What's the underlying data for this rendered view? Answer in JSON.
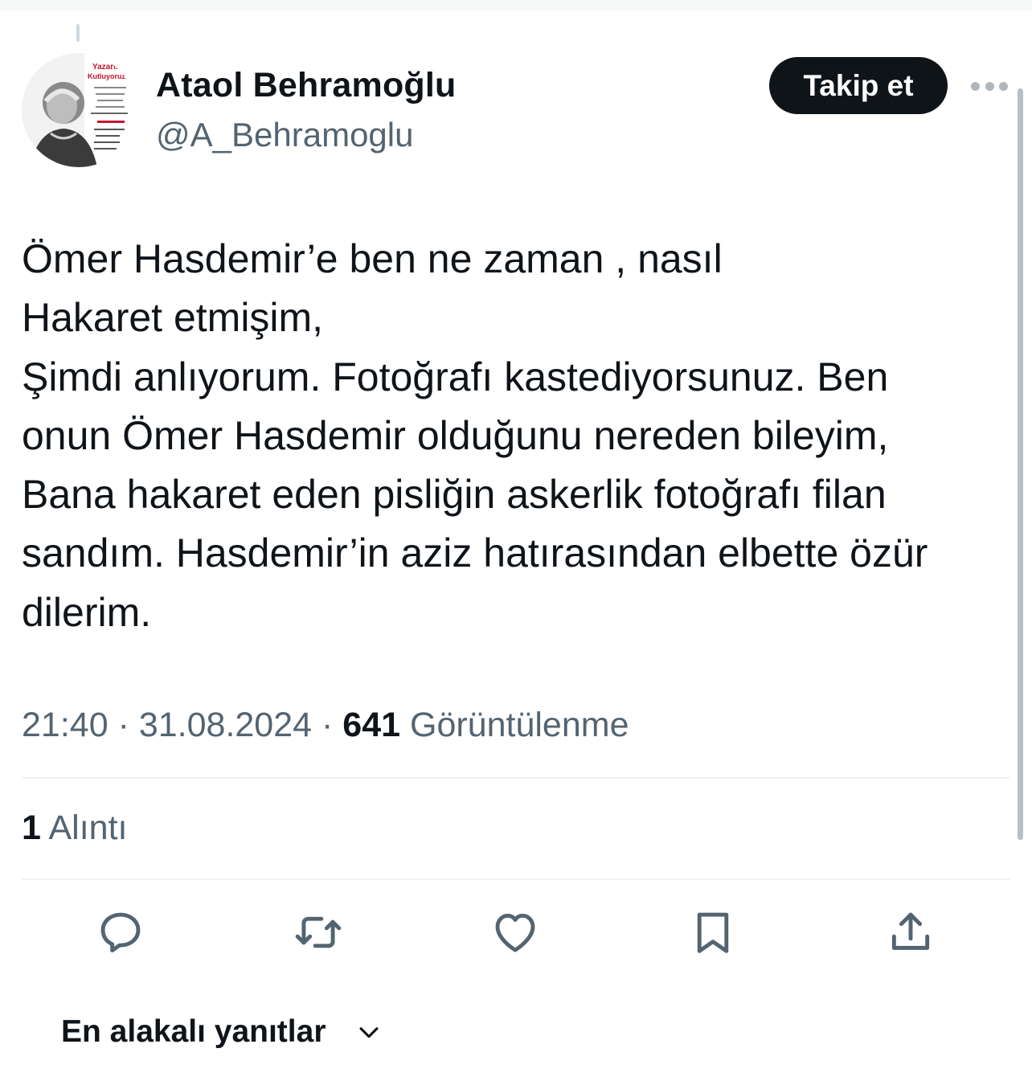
{
  "author": {
    "display_name": "Ataol Behramoğlu",
    "handle": "@A_Behramoglu",
    "avatar_lines": [
      "Yazarı..",
      "Kutluyoruz.."
    ]
  },
  "follow_button": {
    "label": "Takip et"
  },
  "more_icon": "more-horizontal-icon",
  "tweet": {
    "lines": [
      "Ömer Hasdemir’e ben ne zaman , nasıl",
      "Hakaret etmişim,",
      "Şimdi anlıyorum. Fotoğrafı kastediyorsunuz. Ben",
      "onun Ömer Hasdemir olduğunu nereden bileyim,",
      "Bana hakaret eden pisliğin askerlik fotoğrafı filan",
      "sandım. Hasdemir’in aziz hatırasından elbette özür",
      "dilerim."
    ]
  },
  "meta": {
    "time": "21:40",
    "date": "31.08.2024",
    "separator": "·",
    "views_count": "641",
    "views_label": "Görüntülenme"
  },
  "stats": {
    "quotes_count": "1",
    "quotes_label": "Alıntı"
  },
  "actions": [
    "reply-icon",
    "retweet-icon",
    "like-icon",
    "bookmark-icon",
    "share-icon"
  ],
  "replies_sort": {
    "label": "En alakalı yanıtlar",
    "icon": "chevron-down-icon"
  },
  "colors": {
    "text": "#0f1419",
    "secondary": "#536471",
    "button_bg": "#0f1419",
    "divider": "#eff3f4"
  }
}
